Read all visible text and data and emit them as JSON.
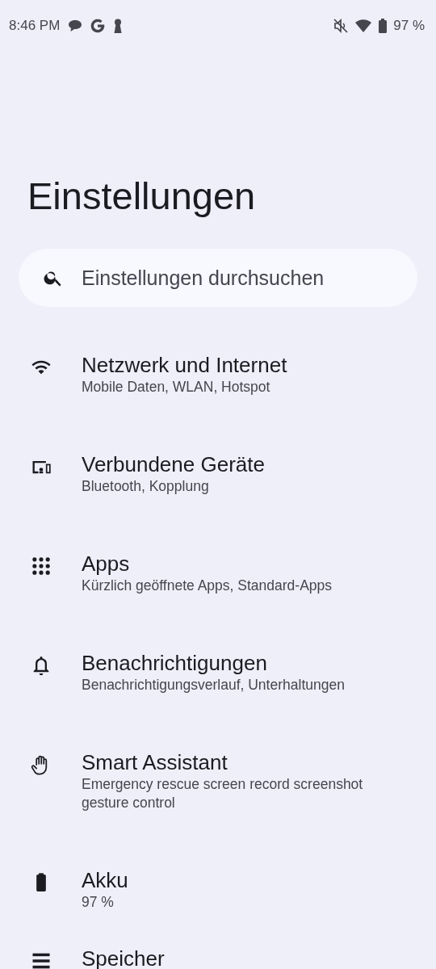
{
  "status_bar": {
    "time": "8:46 PM",
    "battery": "97 %"
  },
  "title": "Einstellungen",
  "search": {
    "placeholder": "Einstellungen durchsuchen"
  },
  "items": [
    {
      "title": "Netzwerk und Internet",
      "subtitle": "Mobile Daten, WLAN, Hotspot"
    },
    {
      "title": "Verbundene Geräte",
      "subtitle": "Bluetooth, Kopplung"
    },
    {
      "title": "Apps",
      "subtitle": "Kürzlich geöffnete Apps, Standard-Apps"
    },
    {
      "title": "Benachrichtigungen",
      "subtitle": "Benachrichtigungsverlauf, Unterhaltungen"
    },
    {
      "title": "Smart Assistant",
      "subtitle": "Emergency rescue screen record screenshot gesture control"
    },
    {
      "title": "Akku",
      "subtitle": "97 %"
    },
    {
      "title": "Speicher"
    }
  ]
}
